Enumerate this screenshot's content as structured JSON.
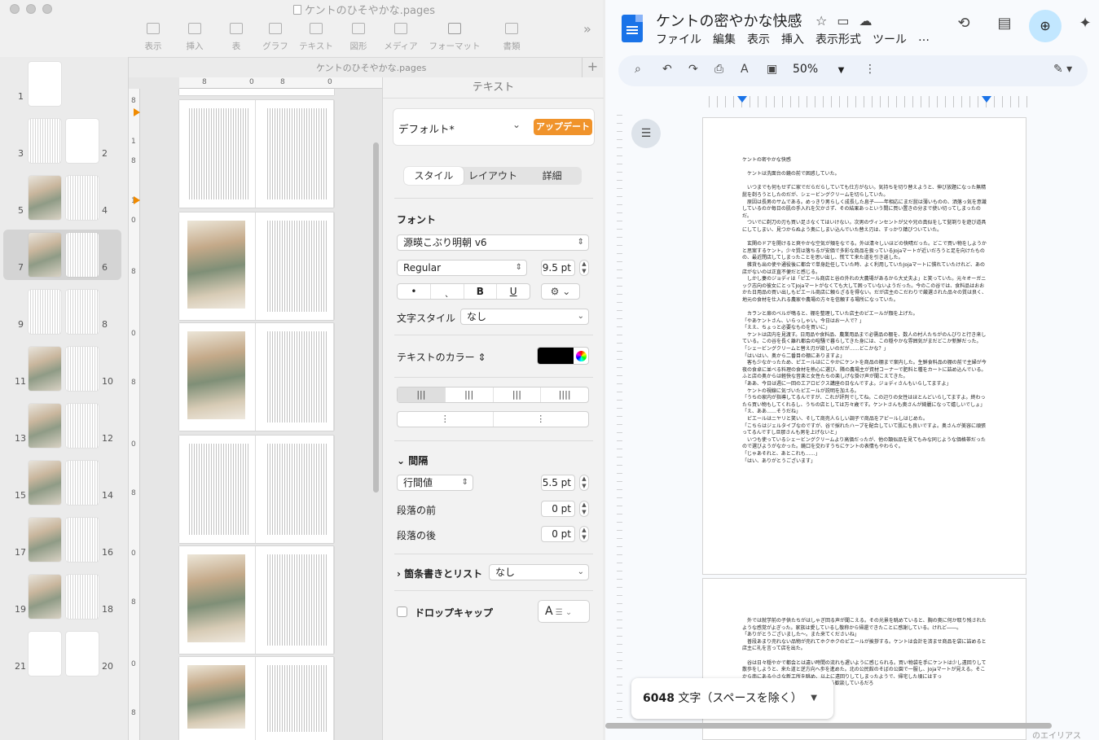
{
  "pages_app": {
    "window_title": "ケントのひそやかな.pages",
    "tab_name": "ケントのひそやかな.pages",
    "toolbar": [
      {
        "label": "表示",
        "icon": "view-icon"
      },
      {
        "label": "挿入",
        "icon": "insert-icon"
      },
      {
        "label": "表",
        "icon": "table-icon"
      },
      {
        "label": "グラフ",
        "icon": "chart-icon"
      },
      {
        "label": "テキスト",
        "icon": "text-icon"
      },
      {
        "label": "図形",
        "icon": "shape-icon"
      },
      {
        "label": "メディア",
        "icon": "media-icon"
      },
      {
        "label": "フォーマット",
        "icon": "format-icon"
      },
      {
        "label": "書類",
        "icon": "document-icon"
      }
    ],
    "thumbnails": [
      {
        "left": "1",
        "right": ""
      },
      {
        "left": "3",
        "right": "2"
      },
      {
        "left": "5",
        "right": "4"
      },
      {
        "left": "7",
        "right": "6"
      },
      {
        "left": "9",
        "right": "8"
      },
      {
        "left": "11",
        "right": "10"
      },
      {
        "left": "13",
        "right": "12"
      },
      {
        "left": "15",
        "right": "14"
      },
      {
        "left": "17",
        "right": "16"
      },
      {
        "left": "19",
        "right": "18"
      },
      {
        "left": "21",
        "right": "20"
      }
    ],
    "ruler_h_labels": [
      "8",
      "0",
      "8",
      "0"
    ],
    "ruler_v_labels": [
      "8",
      "1",
      "8",
      "1",
      "0",
      "8",
      "0",
      "8",
      "0",
      "8",
      "0",
      "8",
      "0",
      "8",
      "0"
    ],
    "inspector": {
      "header": "テキスト",
      "paragraph_style": "デフォルト*",
      "update_button": "アップデート",
      "tabs": [
        "スタイル",
        "レイアウト",
        "詳細"
      ],
      "font_section": "フォント",
      "font_name": "源暎こぶり明朝 v6",
      "font_weight": "Regular",
      "font_size": "9.5 pt",
      "format_buttons": [
        "•",
        "ˎ",
        "B",
        "U"
      ],
      "char_style_label": "文字スタイル",
      "char_style_value": "なし",
      "text_color_label": "テキストのカラー",
      "text_color": "#000000",
      "spacing_section": "間隔",
      "line_spacing_mode": "行間値",
      "line_spacing_value": "5.5 pt",
      "before_paragraph_label": "段落の前",
      "before_paragraph_value": "0 pt",
      "after_paragraph_label": "段落の後",
      "after_paragraph_value": "0 pt",
      "bullets_label": "箇条書きとリスト",
      "bullets_value": "なし",
      "dropcap_label": "ドロップキャップ",
      "dropcap_preview": "A"
    }
  },
  "gdocs": {
    "title": "ケントの密やかな快感",
    "menu": [
      "ファイル",
      "編集",
      "表示",
      "挿入",
      "表示形式",
      "ツール",
      "…"
    ],
    "zoom": "50%",
    "page1_text": "ケントの密やかな快感\n\n　ケントは洗面台の鏡の前で困惑していた。\n\n　いつまでも何もせずに家でだらだらしていても仕方がない。気持ちを切り替えようと、伸び放題になった無精髭を剃ろうとしたのだが、シェービングクリームを切らしていた。\n　原因は長男のサムである。めっきり男らしく成長した息子――年相応にまだ髭は薄いものの、洒落っ気を意識しているのか毎日の肌の手入れを欠かさず、その結果あっという間に買い置きの分まで使い切ってしまったのだ。\n　ついでに剃刀の刃も買い足さなくてはいけない。次男のヴィンセントが父や兄の真似をして髭剃りを遊び道具にしてしまい、見つからぬよう奥にしまい込んでいた替え刃は、すっかり錆びついていた。\n\n　玄関のドアを開けると爽やかな空気が頬をなでる。外は清々しいほどの快晴だった。どこで買い物をしようかと思案するケント。少々質は落ちるが安価で多彩な商品を扱っているJojaマートが近いだろうと足を向けたものの、最近閉店してしまったことを思い出し、慌てて来た道を引き返した。\n　雑貨も出の使や通役後に都合で単身赴任していた時、よく利用していたJojaマートに慣れていたけれど、あの店がないのは正直不便だと感じる。\n　しかし妻のジョディは「ピエール商店と谷の外れの大農場があるから大丈夫よ」と笑っていた。元々オーガニック志向の彼女にとってJojaマートがなくても大して困っていないようだった。今のこの谷では、食料品はおおかた日用品の買い出しもピエール商店に頼らざるを得ない。だが店主のこだわりで厳選された品々の質は良く、地元の食材を仕入れる農家や農場の方々を信頼する場所になっていた。\n\n　カランと扉のベルが鳴ると、棚を整理していた店主のピエールが顔を上げた。\n「やあケントさん、いらっしゃい。今日はお一人で？」\n「ええ、ちょっと必要なものを買いに」\n　ケントは店内を見渡す。日用品や食料品、農業用品まで必需品の棚を、数人の村人たちがのんびりと行き来している。この谷を長く離れ都会の喧騒で暮らしてきた身には、この穏やかな雰囲気がまだどこか新鮮だった。\n「シェービングクリームと替え刃が欲しいのだが……どこかな？」\n「はいはい、奥から二番目の棚にありますよ」\n　客も少なかったため、ピエールはにこやかにケントを商品の棚まで案内した。生鮮食料品の棚の前で主婦が今夜の食卓に並べる料理の食材を熱心に選び、隣の農場主が資材コーナーで肥料と種をカートに詰め込んでいる。ふと店の奥からは軽快な音楽と女性たちの楽しげな掛け声が聞こえてきた。\n「ああ、今日は週に一回のエアロビクス講座の日なんですよ。ジョディさんもいらしてますよ」\n　ケントの視線に気づいたピエールが説明を加える。\n「うちの家内が指導してるんですが、これが評判でしてね。この辺りの女性はほとんどいらしてますよ。終わったら買い物もしてくれるし、うちの店としては万々歳です。ケントさんも奥さんが綺麗になって嬉しいでしょ」\n「え、ああ……そうだね」\n　ピエールはニヤリと笑い、そして商売人らしい調子で商品をアピールしはじめた。\n「こちらはジェルタイプなのですが、谷で採れたハーブを配合していて肌にも良いですよ。奥さんが美容に頑張ってるんですし旦那さんも男を上げないと」\n　いつも使っているシェービングクリームより高価だったが、他の類似品を見てもみな同じような価格帯だったので選びようがなかった。鏡口を交わすうちにケントの表情もやわらぐ。\n「じゃあそれと、あとこれも……」\n「はい、ありがとうございます」",
    "page2_text": "　外では就学前の子供たちがはしゃぎ回る声が聞こえる。その光景を眺めていると、胸の奥に何か取り残されたような感覚がよぎった。家族は愛しているし敬称から帰還できたことに感謝している。けれど――。\n「ありがとうございました～。また来てくださいね」\n　普段あまり売れない品物が売れてホクホクのピエールが挨拶する。ケントは会計を済ませ商品を袋に詰めると店主に礼を言って店を出た。\n\n　谷は日々穏やかで都会とは違い時間の流れも遅いように感じられる。買い物袋を手にケントは少し遠回りして散歩をしようと、来た道と逆方向へ歩を進めた。北の公民館のそばの公園で一服し、Jojaマートが見える。そこから南にある小さな新工所を眺め、以上に遠回りしてしまったようで、帰宅した頃にはすっ\n　妻はエアロビクス仲間とお茶をしながら歓談しているだろ",
    "word_count_number": "6048",
    "word_count_label": " 文字（スペースを除く）",
    "corner_text": "のエイリアス"
  }
}
